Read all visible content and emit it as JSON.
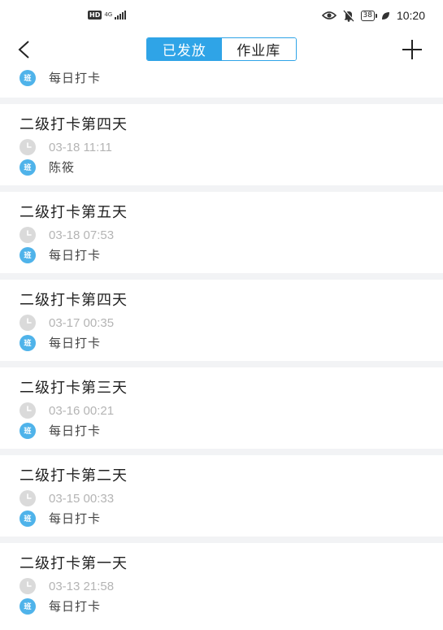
{
  "status_bar": {
    "hd": "HD",
    "network": "4G",
    "battery": "38",
    "time": "10:20",
    "icons": [
      "eye-icon",
      "bell-off-icon",
      "battery-icon",
      "leaf-icon"
    ]
  },
  "nav": {
    "back_icon": "chevron-left-icon",
    "add_icon": "plus-icon",
    "tabs": [
      {
        "label": "已发放",
        "active": true
      },
      {
        "label": "作业库",
        "active": false
      }
    ]
  },
  "class_badge": "班",
  "partial_item": {
    "class_name": "每日打卡"
  },
  "items": [
    {
      "title": "二级打卡第四天",
      "time": "03-18 11:11",
      "class_name": "陈筱"
    },
    {
      "title": "二级打卡第五天",
      "time": "03-18 07:53",
      "class_name": "每日打卡"
    },
    {
      "title": "二级打卡第四天",
      "time": "03-17 00:35",
      "class_name": "每日打卡"
    },
    {
      "title": "二级打卡第三天",
      "time": "03-16 00:21",
      "class_name": "每日打卡"
    },
    {
      "title": "二级打卡第二天",
      "time": "03-15 00:33",
      "class_name": "每日打卡"
    },
    {
      "title": "二级打卡第一天",
      "time": "03-13 21:58",
      "class_name": "每日打卡"
    }
  ],
  "colors": {
    "accent": "#2fa4e7",
    "class_badge": "#4fb3ea",
    "clock_icon": "#dadada",
    "background": "#f2f3f5"
  }
}
